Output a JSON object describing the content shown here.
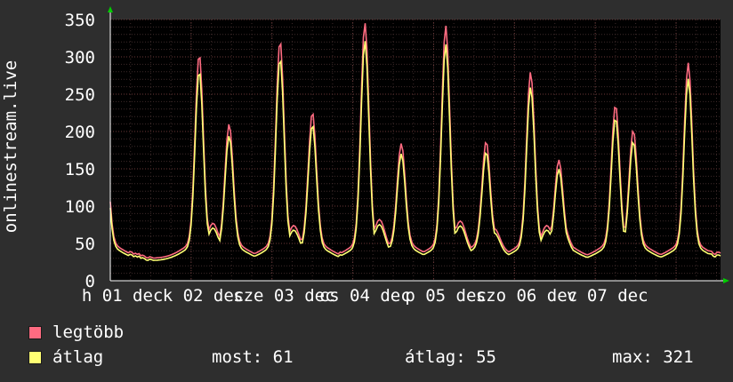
{
  "colors": {
    "background": "#2e2e2e",
    "plot_background": "#000000",
    "grid": "#5a3030",
    "axis_text": "#ffffff",
    "max_series": "#ff6b81",
    "avg_series": "#ffff73",
    "arrow": "#00cc00"
  },
  "chart_data": {
    "type": "line",
    "ylabel": "onlinestream.live",
    "ylim": [
      0,
      350
    ],
    "yticks": [
      0,
      50,
      100,
      150,
      200,
      250,
      300,
      350
    ],
    "xtick_labels": [
      "h 01 dec",
      "k 02 dec",
      "sze 03 dec",
      "cs 04 dec",
      "p 05 dec",
      "szo 06 dec",
      "v 07 dec"
    ],
    "grid": true,
    "legend_position": "bottom-left",
    "series": [
      {
        "name": "legtöbb",
        "color": "#ff6b81",
        "peaks": [
          68,
          180,
          282,
          65,
          188,
          300,
          62,
          204,
          325,
          70,
          162,
          320,
          68,
          165,
          58,
          258,
          62,
          140,
          62,
          214,
          180,
          270
        ]
      },
      {
        "name": "átlag",
        "color": "#ffff73",
        "peaks": [
          60,
          165,
          258,
          58,
          172,
          292,
          55,
          192,
          312,
          63,
          153,
          313,
          60,
          153,
          50,
          240,
          57,
          128,
          55,
          196,
          165,
          265
        ]
      }
    ],
    "day_peaks_max": [
      [
        [
          0.1,
          68
        ],
        [
          0.38,
          180
        ]
      ],
      [
        [
          0.55,
          282
        ],
        [
          0.72,
          65
        ],
        [
          0.92,
          188
        ]
      ],
      [
        [
          0.55,
          300
        ],
        [
          0.72,
          62
        ],
        [
          0.95,
          204
        ]
      ],
      [
        [
          0.6,
          325
        ],
        [
          0.78,
          70
        ]
      ],
      [
        [
          0.05,
          162
        ],
        [
          0.6,
          320
        ],
        [
          0.78,
          68
        ]
      ],
      [
        [
          0.1,
          165
        ],
        [
          0.2,
          58
        ],
        [
          0.65,
          258
        ],
        [
          0.85,
          62
        ]
      ],
      [
        [
          0.0,
          140
        ],
        [
          0.05,
          62
        ],
        [
          0.7,
          214
        ],
        [
          0.92,
          180
        ]
      ],
      [
        [
          0.6,
          270
        ]
      ]
    ]
  },
  "legend": {
    "items": [
      {
        "label": "legtöbb",
        "color": "#ff6b81"
      },
      {
        "label": "átlag",
        "color": "#ffff73"
      }
    ],
    "stats": {
      "most": "most: 61",
      "atlag": "átlag: 55",
      "max": "max: 321"
    }
  }
}
